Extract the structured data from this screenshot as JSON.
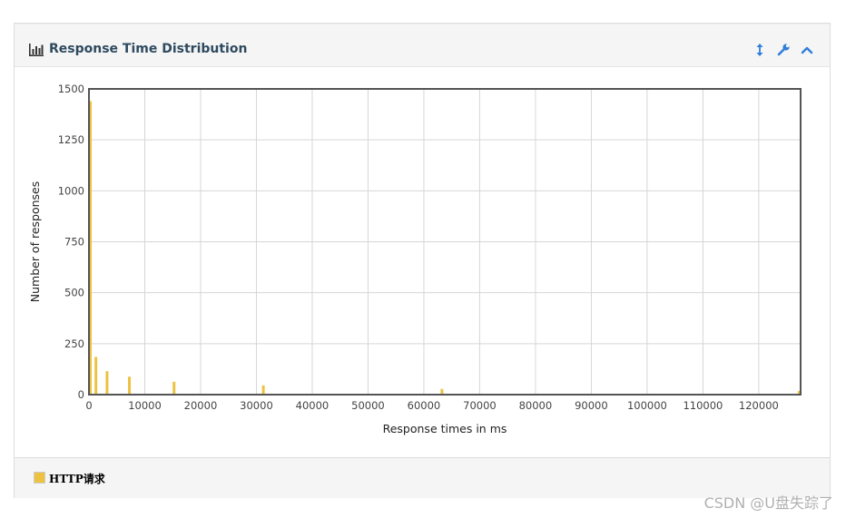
{
  "panel": {
    "title": "Response Time Distribution",
    "icons": {
      "title": "bar-chart-icon",
      "resize": "vertical-resize-icon",
      "settings": "wrench-icon",
      "collapse": "chevron-up-icon"
    }
  },
  "legend": {
    "label": "HTTP请求"
  },
  "watermark": "CSDN @U盘失踪了",
  "colors": {
    "series": "#edc240",
    "accent": "#2f7ed8",
    "title": "#2e4a5f"
  },
  "chart_data": {
    "type": "bar",
    "xlabel": "Response times in ms",
    "ylabel": "Number of responses",
    "xlim": [
      0,
      127500
    ],
    "ylim": [
      0,
      1500
    ],
    "xticks": [
      0,
      10000,
      20000,
      30000,
      40000,
      50000,
      60000,
      70000,
      80000,
      90000,
      100000,
      110000,
      120000
    ],
    "yticks": [
      0,
      250,
      500,
      750,
      1000,
      1250,
      1500
    ],
    "grid": true,
    "legend_position": "bottom-left",
    "series": [
      {
        "name": "HTTP请求",
        "x": [
          0,
          1000,
          3000,
          7000,
          15000,
          31000,
          63000,
          127000
        ],
        "y": [
          1440,
          185,
          115,
          88,
          63,
          45,
          28,
          18
        ]
      }
    ]
  }
}
